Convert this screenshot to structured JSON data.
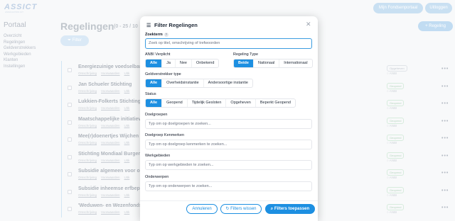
{
  "header": {
    "logo": "ASSICT",
    "logo_sub": "ASSOCIATION ICT",
    "portal_button": "Mijn Fondsenportaal",
    "logout_button": "Uitloggen"
  },
  "sidebar": {
    "title": "Portaal",
    "items": [
      "Overzicht",
      "Regelingen",
      "Geldverstrekkers",
      "Werkgebieden",
      "Klanten",
      "Instellingen"
    ]
  },
  "page": {
    "title": "Regelingen",
    "count": "(0 - 25 / 10",
    "filter_button": "Filter",
    "new_button": "Regeling"
  },
  "list": {
    "link_labels": [
      "Omschrijving",
      "Voorwaarden",
      "Uitk"
    ],
    "anbi_label": "ANBI",
    "rows": [
      {
        "name": "Energiezuinige voedselban",
        "status": "Opgeheven"
      },
      {
        "name": "Jan Schueler Stichting",
        "status": "Geopend"
      },
      {
        "name": "Lukkien-Folkerts Stichting",
        "status": "Geopend"
      },
      {
        "name": "Maatschappelijke initiatiev",
        "status": "Geopend"
      },
      {
        "name": "Mee(r)doenertjes Wijchen",
        "status": "Geopend"
      },
      {
        "name": "Stichting Mondiaal Burgers",
        "status": "Geopend"
      },
      {
        "name": "Subsidie algemeen voor on",
        "status": "Geopend"
      },
      {
        "name": "Subsidie inheemse erfbepl",
        "status": "Geopend"
      },
      {
        "name": "'Weduwen- en Wezenfonds",
        "status": "Geopend"
      }
    ]
  },
  "modal": {
    "title": "Filter Regelingen",
    "zoekterm_label": "Zoekterm",
    "help": "?",
    "search_placeholder": "Zoek op titel, omschrijving of trefwoorden",
    "anbi_label": "ANBI Verplicht",
    "anbi_options": [
      "Alle",
      "Ja",
      "Nee",
      "Onbekend"
    ],
    "type_label": "Regeling Type",
    "type_options": [
      "Beide",
      "Nationaal",
      "Internationaal"
    ],
    "geld_label": "Geldverstrekker type",
    "geld_options": [
      "Alle",
      "Overheidsinstantie",
      "Andersoortige instantie"
    ],
    "status_label": "Status",
    "status_options": [
      "Alle",
      "Geopend",
      "Tijdelijk Gesloten",
      "Opgeheven",
      "Beperkt Geopend"
    ],
    "doelgroepen_label": "Doelgroepen",
    "doelgroepen_placeholder": "Typ om op doelgroepen te zoeken...",
    "kenmerken_label": "Doelgroep Kenmerken",
    "kenmerken_placeholder": "Typ om op doelgroep kenmerken te zoeken...",
    "werkgebieden_label": "Werkgebieden",
    "werkgebieden_placeholder": "Typ om op werkgebieden te zoeken...",
    "onderwerpen_label": "Onderwerpen",
    "onderwerpen_placeholder": "Typ om op onderwerpen te zoeken...",
    "cancel": "Annuleren",
    "clear": "Filters wissen",
    "apply": "Filters toepassen"
  }
}
